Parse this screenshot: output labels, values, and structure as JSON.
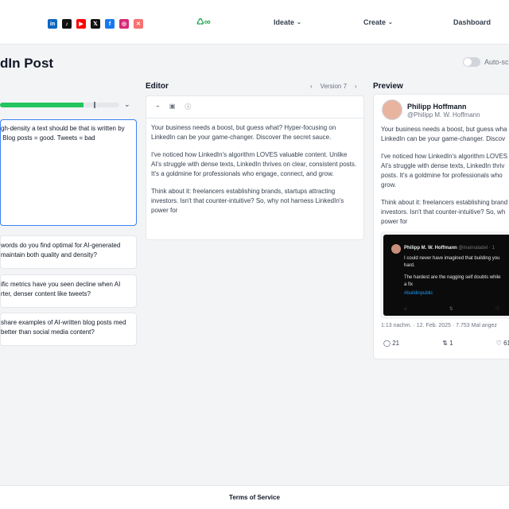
{
  "header": {
    "social_icons": [
      {
        "name": "linkedin-icon",
        "glyph": "in",
        "color": "#0a66c2"
      },
      {
        "name": "tiktok-icon",
        "glyph": "♪",
        "color": "#111111"
      },
      {
        "name": "youtube-icon",
        "glyph": "▶",
        "color": "#ff0000"
      },
      {
        "name": "x-icon",
        "glyph": "𝕏",
        "color": "#111111"
      },
      {
        "name": "facebook-icon",
        "glyph": "f",
        "color": "#1877f2"
      },
      {
        "name": "instagram-icon",
        "glyph": "◎",
        "color": "#d62976"
      },
      {
        "name": "bluesky-icon",
        "glyph": "✕",
        "color": "#f87171"
      }
    ],
    "logo": "♺∞",
    "nav": {
      "ideate": "Ideate",
      "create": "Create",
      "dashboard": "Dashboard"
    }
  },
  "page": {
    "title": "dIn Post",
    "auto_schedule_label": "Auto-sch"
  },
  "progress": {
    "value_percent": 70
  },
  "prompt": {
    "text": "gh-density a text should be that is written by\n Blog posts = good. Tweets = bad"
  },
  "questions": [
    "words do you find optimal for AI-generated\n maintain both quality and density?",
    "ific metrics have you seen decline when AI\nrter, denser content like tweets?",
    "share examples of AI-written blog posts\nmed better than social media content?"
  ],
  "editor": {
    "title": "Editor",
    "version_prev": "‹",
    "version_label": "Version 7",
    "version_next": "›",
    "toolbar": {
      "rss": "⌁",
      "image": "▣",
      "info": "ⓘ"
    },
    "paragraphs": [
      "Your business needs a boost, but guess what? Hyper-focusing on LinkedIn can be your game-changer. Discover the secret sauce.",
      "I've noticed how LinkedIn's algorithm LOVES valuable content. Unlike AI's struggle with dense texts, LinkedIn thrives on clear, consistent posts. It's a goldmine for professionals who engage, connect, and grow.",
      "Think about it: freelancers establishing brands, startups attracting investors. Isn't that counter-intuitive? So, why not harness LinkedIn's power for"
    ]
  },
  "preview": {
    "title": "Preview",
    "name": "Philipp Hoffmann",
    "handle": "@Philipp M. W. Hoffmann",
    "lines": [
      [
        "Your business needs a boost, but guess wha",
        "LinkedIn can be your game-changer. Discov"
      ],
      [
        "I've noticed how LinkedIn's algorithm LOVES",
        "AI's struggle with dense texts, LinkedIn thriv",
        "posts. It's a goldmine for professionals who",
        "grow."
      ],
      [
        "Think about it: freelancers establishing brand",
        "investors. Isn't that counter-intuitive? So, wh",
        "power for"
      ]
    ],
    "tweet": {
      "name": "Philipp M. W. Hoffmann",
      "handle": "@maimaladel · 1",
      "text1": "I could never have imagined that building you\nhard.",
      "text2": "The hardest are the nagging self doubts while\na fix",
      "hashtag": "#buildinpublic",
      "actions": [
        "○",
        "⇅",
        "♡"
      ]
    },
    "timestamp": "1:13 nachm. · 12. Feb. 2025 · 7.753 Mal angez",
    "actions": {
      "comments": "21",
      "reposts": "1",
      "likes": "61"
    }
  },
  "footer": {
    "terms": "Terms of Service"
  }
}
